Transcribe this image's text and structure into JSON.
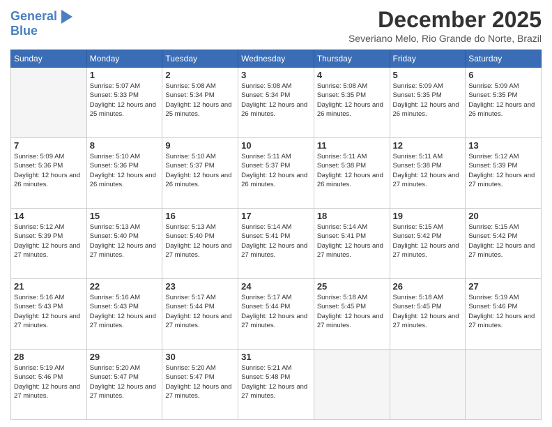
{
  "logo": {
    "line1": "General",
    "line2": "Blue"
  },
  "title": "December 2025",
  "location": "Severiano Melo, Rio Grande do Norte, Brazil",
  "headers": [
    "Sunday",
    "Monday",
    "Tuesday",
    "Wednesday",
    "Thursday",
    "Friday",
    "Saturday"
  ],
  "weeks": [
    [
      {
        "day": "",
        "sunrise": "",
        "sunset": "",
        "daylight": ""
      },
      {
        "day": "1",
        "sunrise": "Sunrise: 5:07 AM",
        "sunset": "Sunset: 5:33 PM",
        "daylight": "Daylight: 12 hours and 25 minutes."
      },
      {
        "day": "2",
        "sunrise": "Sunrise: 5:08 AM",
        "sunset": "Sunset: 5:34 PM",
        "daylight": "Daylight: 12 hours and 25 minutes."
      },
      {
        "day": "3",
        "sunrise": "Sunrise: 5:08 AM",
        "sunset": "Sunset: 5:34 PM",
        "daylight": "Daylight: 12 hours and 26 minutes."
      },
      {
        "day": "4",
        "sunrise": "Sunrise: 5:08 AM",
        "sunset": "Sunset: 5:35 PM",
        "daylight": "Daylight: 12 hours and 26 minutes."
      },
      {
        "day": "5",
        "sunrise": "Sunrise: 5:09 AM",
        "sunset": "Sunset: 5:35 PM",
        "daylight": "Daylight: 12 hours and 26 minutes."
      },
      {
        "day": "6",
        "sunrise": "Sunrise: 5:09 AM",
        "sunset": "Sunset: 5:35 PM",
        "daylight": "Daylight: 12 hours and 26 minutes."
      }
    ],
    [
      {
        "day": "7",
        "sunrise": "Sunrise: 5:09 AM",
        "sunset": "Sunset: 5:36 PM",
        "daylight": "Daylight: 12 hours and 26 minutes."
      },
      {
        "day": "8",
        "sunrise": "Sunrise: 5:10 AM",
        "sunset": "Sunset: 5:36 PM",
        "daylight": "Daylight: 12 hours and 26 minutes."
      },
      {
        "day": "9",
        "sunrise": "Sunrise: 5:10 AM",
        "sunset": "Sunset: 5:37 PM",
        "daylight": "Daylight: 12 hours and 26 minutes."
      },
      {
        "day": "10",
        "sunrise": "Sunrise: 5:11 AM",
        "sunset": "Sunset: 5:37 PM",
        "daylight": "Daylight: 12 hours and 26 minutes."
      },
      {
        "day": "11",
        "sunrise": "Sunrise: 5:11 AM",
        "sunset": "Sunset: 5:38 PM",
        "daylight": "Daylight: 12 hours and 26 minutes."
      },
      {
        "day": "12",
        "sunrise": "Sunrise: 5:11 AM",
        "sunset": "Sunset: 5:38 PM",
        "daylight": "Daylight: 12 hours and 27 minutes."
      },
      {
        "day": "13",
        "sunrise": "Sunrise: 5:12 AM",
        "sunset": "Sunset: 5:39 PM",
        "daylight": "Daylight: 12 hours and 27 minutes."
      }
    ],
    [
      {
        "day": "14",
        "sunrise": "Sunrise: 5:12 AM",
        "sunset": "Sunset: 5:39 PM",
        "daylight": "Daylight: 12 hours and 27 minutes."
      },
      {
        "day": "15",
        "sunrise": "Sunrise: 5:13 AM",
        "sunset": "Sunset: 5:40 PM",
        "daylight": "Daylight: 12 hours and 27 minutes."
      },
      {
        "day": "16",
        "sunrise": "Sunrise: 5:13 AM",
        "sunset": "Sunset: 5:40 PM",
        "daylight": "Daylight: 12 hours and 27 minutes."
      },
      {
        "day": "17",
        "sunrise": "Sunrise: 5:14 AM",
        "sunset": "Sunset: 5:41 PM",
        "daylight": "Daylight: 12 hours and 27 minutes."
      },
      {
        "day": "18",
        "sunrise": "Sunrise: 5:14 AM",
        "sunset": "Sunset: 5:41 PM",
        "daylight": "Daylight: 12 hours and 27 minutes."
      },
      {
        "day": "19",
        "sunrise": "Sunrise: 5:15 AM",
        "sunset": "Sunset: 5:42 PM",
        "daylight": "Daylight: 12 hours and 27 minutes."
      },
      {
        "day": "20",
        "sunrise": "Sunrise: 5:15 AM",
        "sunset": "Sunset: 5:42 PM",
        "daylight": "Daylight: 12 hours and 27 minutes."
      }
    ],
    [
      {
        "day": "21",
        "sunrise": "Sunrise: 5:16 AM",
        "sunset": "Sunset: 5:43 PM",
        "daylight": "Daylight: 12 hours and 27 minutes."
      },
      {
        "day": "22",
        "sunrise": "Sunrise: 5:16 AM",
        "sunset": "Sunset: 5:43 PM",
        "daylight": "Daylight: 12 hours and 27 minutes."
      },
      {
        "day": "23",
        "sunrise": "Sunrise: 5:17 AM",
        "sunset": "Sunset: 5:44 PM",
        "daylight": "Daylight: 12 hours and 27 minutes."
      },
      {
        "day": "24",
        "sunrise": "Sunrise: 5:17 AM",
        "sunset": "Sunset: 5:44 PM",
        "daylight": "Daylight: 12 hours and 27 minutes."
      },
      {
        "day": "25",
        "sunrise": "Sunrise: 5:18 AM",
        "sunset": "Sunset: 5:45 PM",
        "daylight": "Daylight: 12 hours and 27 minutes."
      },
      {
        "day": "26",
        "sunrise": "Sunrise: 5:18 AM",
        "sunset": "Sunset: 5:45 PM",
        "daylight": "Daylight: 12 hours and 27 minutes."
      },
      {
        "day": "27",
        "sunrise": "Sunrise: 5:19 AM",
        "sunset": "Sunset: 5:46 PM",
        "daylight": "Daylight: 12 hours and 27 minutes."
      }
    ],
    [
      {
        "day": "28",
        "sunrise": "Sunrise: 5:19 AM",
        "sunset": "Sunset: 5:46 PM",
        "daylight": "Daylight: 12 hours and 27 minutes."
      },
      {
        "day": "29",
        "sunrise": "Sunrise: 5:20 AM",
        "sunset": "Sunset: 5:47 PM",
        "daylight": "Daylight: 12 hours and 27 minutes."
      },
      {
        "day": "30",
        "sunrise": "Sunrise: 5:20 AM",
        "sunset": "Sunset: 5:47 PM",
        "daylight": "Daylight: 12 hours and 27 minutes."
      },
      {
        "day": "31",
        "sunrise": "Sunrise: 5:21 AM",
        "sunset": "Sunset: 5:48 PM",
        "daylight": "Daylight: 12 hours and 27 minutes."
      },
      {
        "day": "",
        "sunrise": "",
        "sunset": "",
        "daylight": ""
      },
      {
        "day": "",
        "sunrise": "",
        "sunset": "",
        "daylight": ""
      },
      {
        "day": "",
        "sunrise": "",
        "sunset": "",
        "daylight": ""
      }
    ]
  ]
}
